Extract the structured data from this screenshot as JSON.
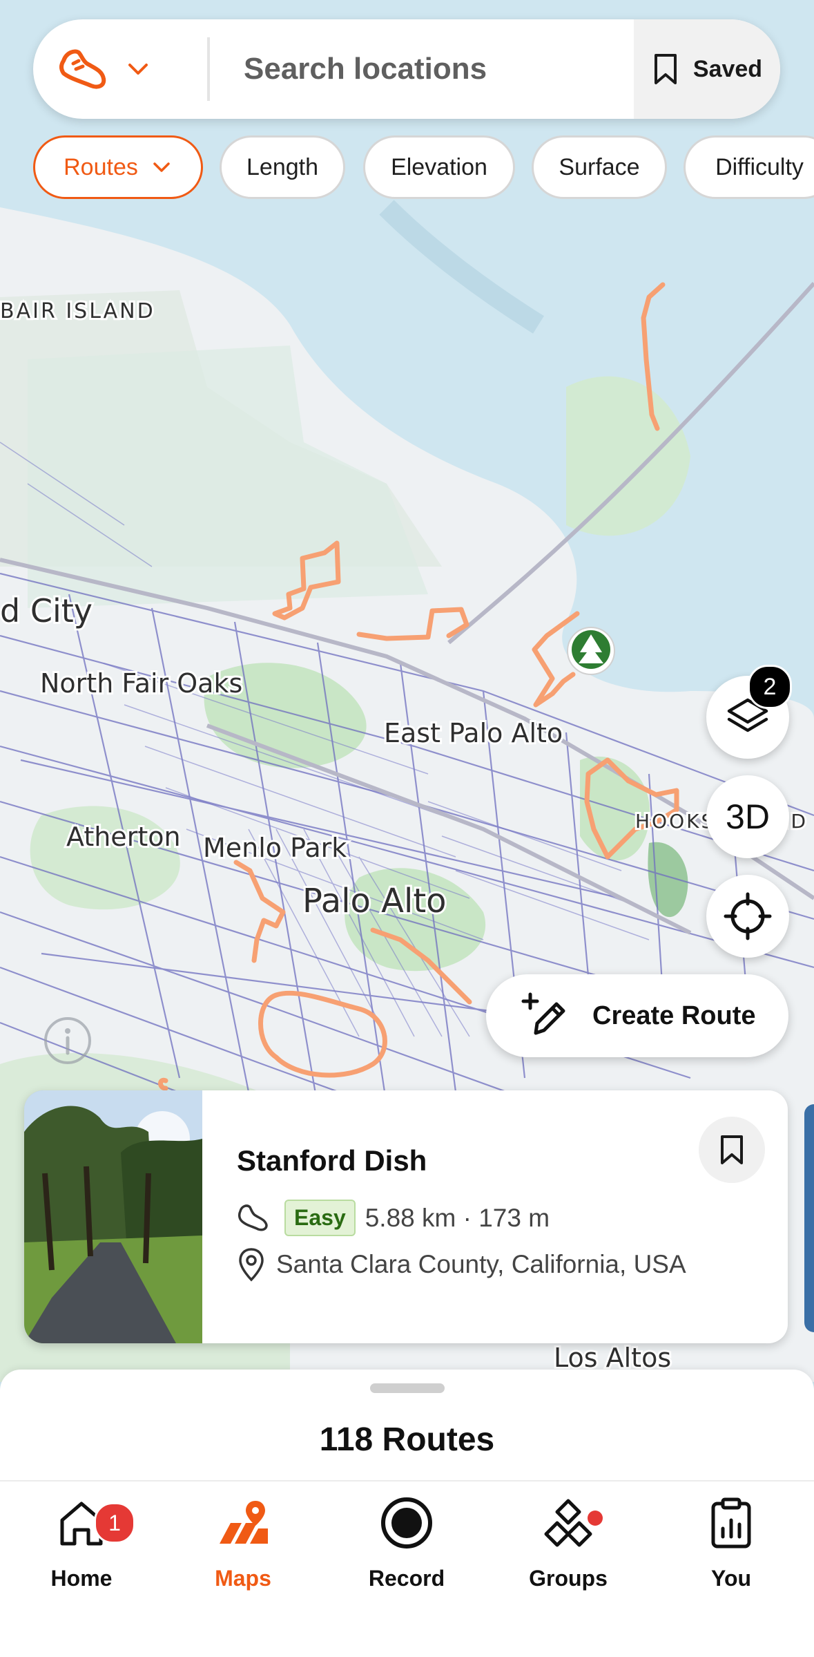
{
  "search": {
    "placeholder": "Search locations",
    "saved_label": "Saved"
  },
  "filters": [
    {
      "label": "Routes",
      "active": true
    },
    {
      "label": "Length",
      "active": false
    },
    {
      "label": "Elevation",
      "active": false
    },
    {
      "label": "Surface",
      "active": false
    },
    {
      "label": "Difficulty",
      "active": false
    }
  ],
  "map": {
    "labels": {
      "bair_island": "BAIR ISLAND",
      "redwood_city": "d City",
      "north_fair_oaks": "North Fair Oaks",
      "east_palo_alto": "East Palo Alto",
      "atherton": "Atherton",
      "menlo_park": "Menlo Park",
      "palo_alto": "Palo Alto",
      "hooks_island": "HOOKS ISLAND",
      "los_altos": "Los Altos"
    },
    "layers_badge": "2",
    "btn_3d": "3D",
    "create_route_label": "Create Route"
  },
  "route_card": {
    "title": "Stanford Dish",
    "difficulty": "Easy",
    "stats": "5.88 km · 173 m",
    "location": "Santa Clara County, California, USA"
  },
  "sheet": {
    "title": "118 Routes"
  },
  "nav": {
    "home": {
      "label": "Home",
      "badge": "1"
    },
    "maps": {
      "label": "Maps"
    },
    "record": {
      "label": "Record"
    },
    "groups": {
      "label": "Groups"
    },
    "you": {
      "label": "You"
    }
  },
  "colors": {
    "accent": "#f05a14",
    "route_line": "#f7a072",
    "road_line": "#6f6fbf",
    "water": "#cfe6f0",
    "land": "#eef2f4",
    "park": "#c8e6c9"
  }
}
